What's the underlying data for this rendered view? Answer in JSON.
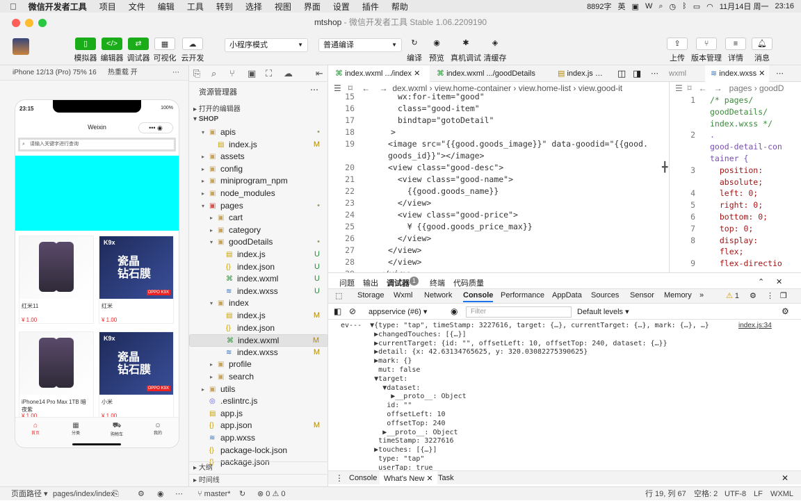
{
  "menubar": {
    "app_name": "微信开发者工具",
    "items": [
      "项目",
      "文件",
      "编辑",
      "工具",
      "转到",
      "选择",
      "视图",
      "界面",
      "设置",
      "插件",
      "帮助"
    ],
    "right_text": "8892字",
    "date": "11月14日 周一",
    "time": "23:16"
  },
  "window": {
    "title": "mtshop",
    "subtitle": " - 微信开发者工具 Stable 1.06.2209190"
  },
  "toolbar": {
    "left_buttons": [
      "模拟器",
      "编辑器",
      "调试器",
      "可视化",
      "云开发"
    ],
    "mode_select": "小程序模式",
    "compile_select": "普通编译",
    "mid_buttons": [
      "编译",
      "预览",
      "真机调试",
      "清缓存"
    ],
    "right_buttons": [
      "上传",
      "版本管理",
      "详情",
      "消息"
    ]
  },
  "simulator": {
    "device": "iPhone 12/13 (Pro) 75% 16",
    "hot_reload": "热重载 开",
    "status_time": "23:15",
    "battery": "100%",
    "nav_title": "Weixin",
    "search_placeholder": "请输入关键字进行查询",
    "products": [
      {
        "name": "红米11",
        "price": "¥ 1.00"
      },
      {
        "name": "红米",
        "price": "¥ 1.00"
      },
      {
        "name": "iPhone14 Pro Max 1TB 暗夜紫",
        "price": "¥ 1.00"
      },
      {
        "name": "小米",
        "price": "¥ 1.00"
      }
    ],
    "glass_text": "瓷晶\n钻石膜",
    "glass_model": "K9x",
    "glass_tag": "OPPO K9X",
    "tabs": [
      "首页",
      "分类",
      "购物车",
      "我的"
    ]
  },
  "explorer": {
    "title": "资源管理器",
    "open_editors": "打开的编辑器",
    "root": "SHOP",
    "rows": [
      {
        "name": "apis",
        "type": "folder",
        "depth": 1,
        "open": true,
        "status": "•"
      },
      {
        "name": "index.js",
        "type": "js",
        "depth": 2,
        "status": "M"
      },
      {
        "name": "assets",
        "type": "folder",
        "depth": 1,
        "open": false,
        "status": ""
      },
      {
        "name": "config",
        "type": "folder",
        "depth": 1,
        "open": false,
        "status": ""
      },
      {
        "name": "miniprogram_npm",
        "type": "folder",
        "depth": 1,
        "open": false,
        "status": ""
      },
      {
        "name": "node_modules",
        "type": "folder",
        "depth": 1,
        "open": false,
        "status": ""
      },
      {
        "name": "pages",
        "type": "folder",
        "depth": 1,
        "open": true,
        "status": "•"
      },
      {
        "name": "cart",
        "type": "folder",
        "depth": 2,
        "open": false,
        "status": ""
      },
      {
        "name": "category",
        "type": "folder",
        "depth": 2,
        "open": false,
        "status": ""
      },
      {
        "name": "goodDetails",
        "type": "folder",
        "depth": 2,
        "open": true,
        "status": "•"
      },
      {
        "name": "index.js",
        "type": "js",
        "depth": 3,
        "status": "U"
      },
      {
        "name": "index.json",
        "type": "json",
        "depth": 3,
        "status": "U"
      },
      {
        "name": "index.wxml",
        "type": "wxml",
        "depth": 3,
        "status": "U"
      },
      {
        "name": "index.wxss",
        "type": "wxss",
        "depth": 3,
        "status": "U"
      },
      {
        "name": "index",
        "type": "folder",
        "depth": 2,
        "open": true,
        "status": ""
      },
      {
        "name": "index.js",
        "type": "js",
        "depth": 3,
        "status": "M"
      },
      {
        "name": "index.json",
        "type": "json",
        "depth": 3,
        "status": ""
      },
      {
        "name": "index.wxml",
        "type": "wxml",
        "depth": 3,
        "status": "M",
        "selected": true
      },
      {
        "name": "index.wxss",
        "type": "wxss",
        "depth": 3,
        "status": "M"
      },
      {
        "name": "profile",
        "type": "folder",
        "depth": 2,
        "open": false,
        "status": ""
      },
      {
        "name": "search",
        "type": "folder",
        "depth": 2,
        "open": false,
        "status": ""
      },
      {
        "name": "utils",
        "type": "folder",
        "depth": 1,
        "open": false,
        "status": ""
      },
      {
        "name": ".eslintrc.js",
        "type": "cfg",
        "depth": 1,
        "status": ""
      },
      {
        "name": "app.js",
        "type": "js",
        "depth": 1,
        "status": ""
      },
      {
        "name": "app.json",
        "type": "json",
        "depth": 1,
        "status": "M"
      },
      {
        "name": "app.wxss",
        "type": "wxss",
        "depth": 1,
        "status": ""
      },
      {
        "name": "package-lock.json",
        "type": "json",
        "depth": 1,
        "status": ""
      },
      {
        "name": "package.json",
        "type": "json",
        "depth": 1,
        "status": ""
      }
    ],
    "outline": "大纲",
    "timeline": "时间线"
  },
  "editor": {
    "tabs": [
      "index.wxml .../index",
      "index.wxml .../goodDetails",
      "index.js",
      "wxml",
      "index.wxss"
    ],
    "breadcrumb": [
      "dex.wxml",
      "view.home-container",
      "view.home-list",
      "view.good-it"
    ],
    "css_breadcrumb": [
      "pages",
      "goodD"
    ],
    "lines": [
      {
        "n": "15",
        "t": "wx:for-item=\"good\""
      },
      {
        "n": "16",
        "t": "class=\"good-item\""
      },
      {
        "n": "17",
        "t": "bindtap=\"gotoDetail\""
      },
      {
        "n": "18",
        "t": ">"
      },
      {
        "n": "19",
        "t": "<image src=\"{{good.goods_image}}\" data-goodid=\"{{good."
      },
      {
        "n": "",
        "t": "goods_id}}\"></image>"
      },
      {
        "n": "20",
        "t": "<view class=\"good-desc\">"
      },
      {
        "n": "21",
        "t": "  <view class=\"good-name\">"
      },
      {
        "n": "22",
        "t": "    {{good.goods_name}}"
      },
      {
        "n": "23",
        "t": "  </view>"
      },
      {
        "n": "24",
        "t": "  <view class=\"good-price\">"
      },
      {
        "n": "25",
        "t": "    ¥ {{good.goods_price_max}}"
      },
      {
        "n": "26",
        "t": "  </view>"
      },
      {
        "n": "27",
        "t": "</view>"
      },
      {
        "n": "28",
        "t": "</view>"
      },
      {
        "n": "29",
        "t": "</view>"
      }
    ],
    "css_lines": [
      {
        "n": "1",
        "t": "/* pages/"
      },
      {
        "n": "",
        "t": "goodDetails/"
      },
      {
        "n": "",
        "t": "index.wxss */"
      },
      {
        "n": "2",
        "t": "."
      },
      {
        "n": "",
        "t": "good-detail-con"
      },
      {
        "n": "",
        "t": "tainer {"
      },
      {
        "n": "3",
        "t": "  position:"
      },
      {
        "n": "",
        "t": "  absolute;"
      },
      {
        "n": "4",
        "t": "  left: 0;"
      },
      {
        "n": "5",
        "t": "  right: 0;"
      },
      {
        "n": "6",
        "t": "  bottom: 0;"
      },
      {
        "n": "7",
        "t": "  top: 0;"
      },
      {
        "n": "8",
        "t": "  display:"
      },
      {
        "n": "",
        "t": "  flex;"
      },
      {
        "n": "9",
        "t": "  flex-directio"
      }
    ]
  },
  "devtools": {
    "top_tabs": [
      "问题",
      "输出",
      "调试器",
      "终端",
      "代码质量"
    ],
    "badge": "1",
    "tabs": [
      "Storage",
      "Wxml",
      "Network",
      "Console",
      "Performance",
      "AppData",
      "Sources",
      "Sensor",
      "Memory"
    ],
    "warn_count": "1",
    "context": "appservice (#6)",
    "filter_placeholder": "Filter",
    "levels": "Default levels",
    "source_link": "index.js:34",
    "console_lines": [
      "ev---  ▼{type: \"tap\", timeStamp: 3227616, target: {…}, currentTarget: {…}, mark: {…}, …}",
      "        ▶changedTouches: [{…}]",
      "        ▶currentTarget: {id: \"\", offsetLeft: 10, offsetTop: 240, dataset: {…}}",
      "        ▶detail: {x: 42.63134765625, y: 320.03082275390625}",
      "        ▶mark: {}",
      "         mut: false",
      "        ▼target:",
      "          ▼dataset:",
      "            ▶__proto__: Object",
      "           id: \"\"",
      "           offsetLeft: 10",
      "           offsetTop: 240",
      "          ▶__proto__: Object",
      "         timeStamp: 3227616",
      "        ▶touches: [{…}]",
      "         type: \"tap\"",
      "         userTap: true"
    ],
    "drawer_tabs": [
      "Console",
      "What's New",
      "Task"
    ]
  },
  "status": {
    "path_label": "页面路径",
    "path": "pages/index/index",
    "branch": "master*",
    "errors": "0",
    "warnings": "0",
    "cursor": "行 19, 列 67",
    "spaces": "空格: 2",
    "encoding": "UTF-8",
    "eol": "LF",
    "lang": "WXML"
  }
}
